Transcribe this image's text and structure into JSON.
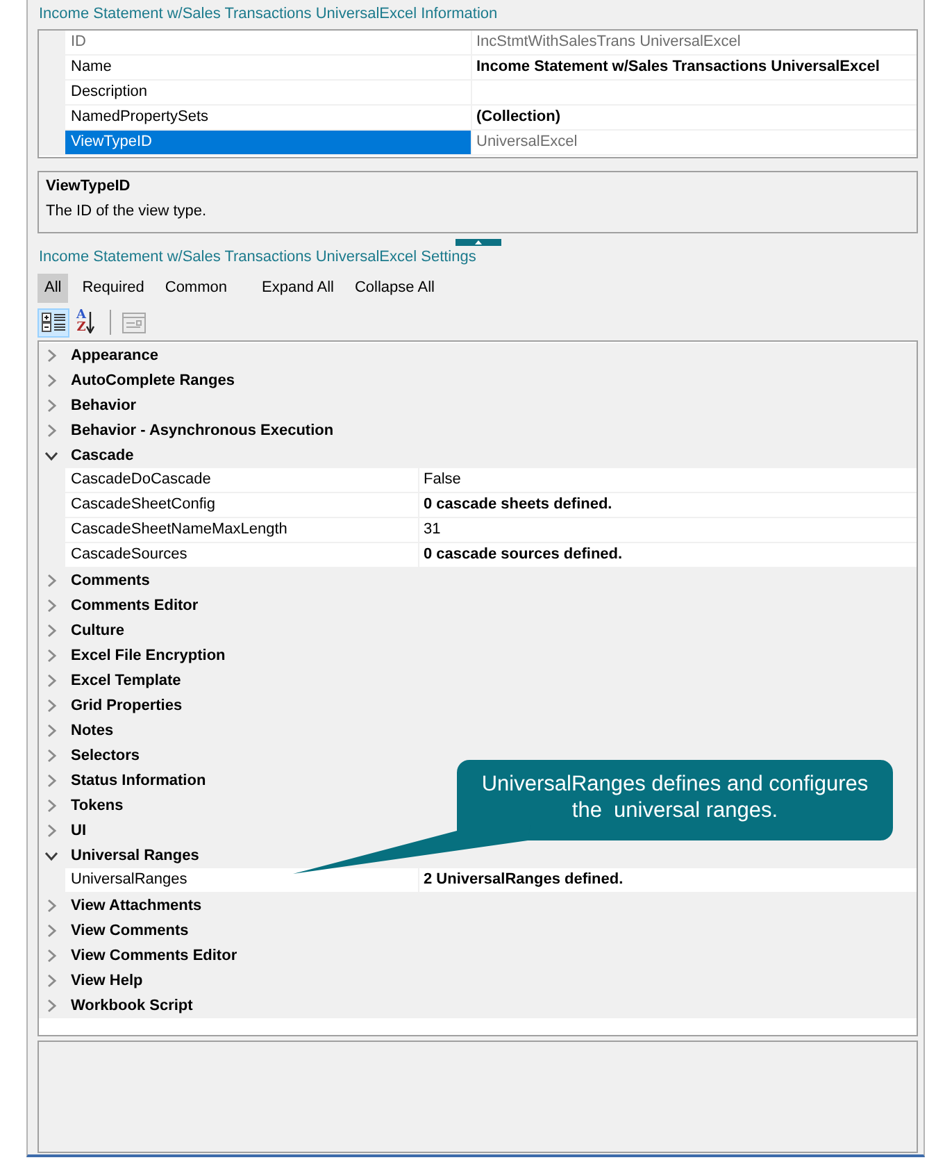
{
  "info": {
    "title": "Income Statement w/Sales Transactions UniversalExcel Information",
    "properties": [
      {
        "name": "ID",
        "value": "IncStmtWithSalesTrans UniversalExcel",
        "read_only": true,
        "bold": false,
        "selected": false
      },
      {
        "name": "Name",
        "value": "Income Statement w/Sales Transactions UniversalExcel",
        "read_only": false,
        "bold": true,
        "selected": false
      },
      {
        "name": "Description",
        "read_only": false,
        "selected": false
      },
      {
        "name": "NamedPropertySets",
        "value": "(Collection)",
        "read_only": false,
        "bold": true,
        "selected": false
      },
      {
        "name": "ViewTypeID",
        "value": "UniversalExcel",
        "read_only": true,
        "bold": false,
        "selected": true
      }
    ]
  },
  "description": {
    "title": "ViewTypeID",
    "text": "The ID of the view type."
  },
  "settings": {
    "title": "Income Statement w/Sales Transactions UniversalExcel Settings",
    "filters": [
      {
        "label": "All",
        "selected": true
      },
      {
        "label": "Required",
        "selected": false
      },
      {
        "label": "Common",
        "selected": false
      }
    ],
    "actions": [
      "Expand All",
      "Collapse All"
    ],
    "toolbar": [
      {
        "kind": "categorized",
        "selected": true
      },
      {
        "kind": "alphabetical",
        "letters": [
          "A",
          "Z"
        ],
        "selected": false
      },
      {
        "kind": "property_pages",
        "disabled": true
      }
    ],
    "categories": [
      {
        "label": "Appearance",
        "expanded": false
      },
      {
        "label": "AutoComplete Ranges",
        "expanded": false
      },
      {
        "label": "Behavior",
        "expanded": false
      },
      {
        "label": "Behavior - Asynchronous Execution",
        "expanded": false
      },
      {
        "label": "Cascade",
        "expanded": true,
        "children": [
          {
            "name": "CascadeDoCascade",
            "value": "False",
            "bold": false
          },
          {
            "name": "CascadeSheetConfig",
            "value": "0 cascade sheets defined.",
            "bold": true
          },
          {
            "name": "CascadeSheetNameMaxLength",
            "value": "31",
            "bold": false
          },
          {
            "name": "CascadeSources",
            "value": "0 cascade sources defined.",
            "bold": true
          }
        ]
      },
      {
        "label": "Comments",
        "expanded": false
      },
      {
        "label": "Comments Editor",
        "expanded": false
      },
      {
        "label": "Culture",
        "expanded": false
      },
      {
        "label": "Excel File Encryption",
        "expanded": false
      },
      {
        "label": "Excel Template",
        "expanded": false
      },
      {
        "label": "Grid Properties",
        "expanded": false
      },
      {
        "label": "Notes",
        "expanded": false
      },
      {
        "label": "Selectors",
        "expanded": false
      },
      {
        "label": "Status Information",
        "expanded": false
      },
      {
        "label": "Tokens",
        "expanded": false
      },
      {
        "label": "UI",
        "expanded": false
      },
      {
        "label": "Universal Ranges",
        "expanded": true,
        "children": [
          {
            "name": "UniversalRanges",
            "value": "2 UniversalRanges defined.",
            "bold": true
          }
        ]
      },
      {
        "label": "View Attachments",
        "expanded": false
      },
      {
        "label": "View Comments",
        "expanded": false
      },
      {
        "label": "View Comments Editor",
        "expanded": false
      },
      {
        "label": "View Help",
        "expanded": false
      },
      {
        "label": "Workbook Script",
        "expanded": false
      }
    ]
  },
  "callout": {
    "text": "UniversalRanges defines and configures\nthe  universal ranges."
  }
}
